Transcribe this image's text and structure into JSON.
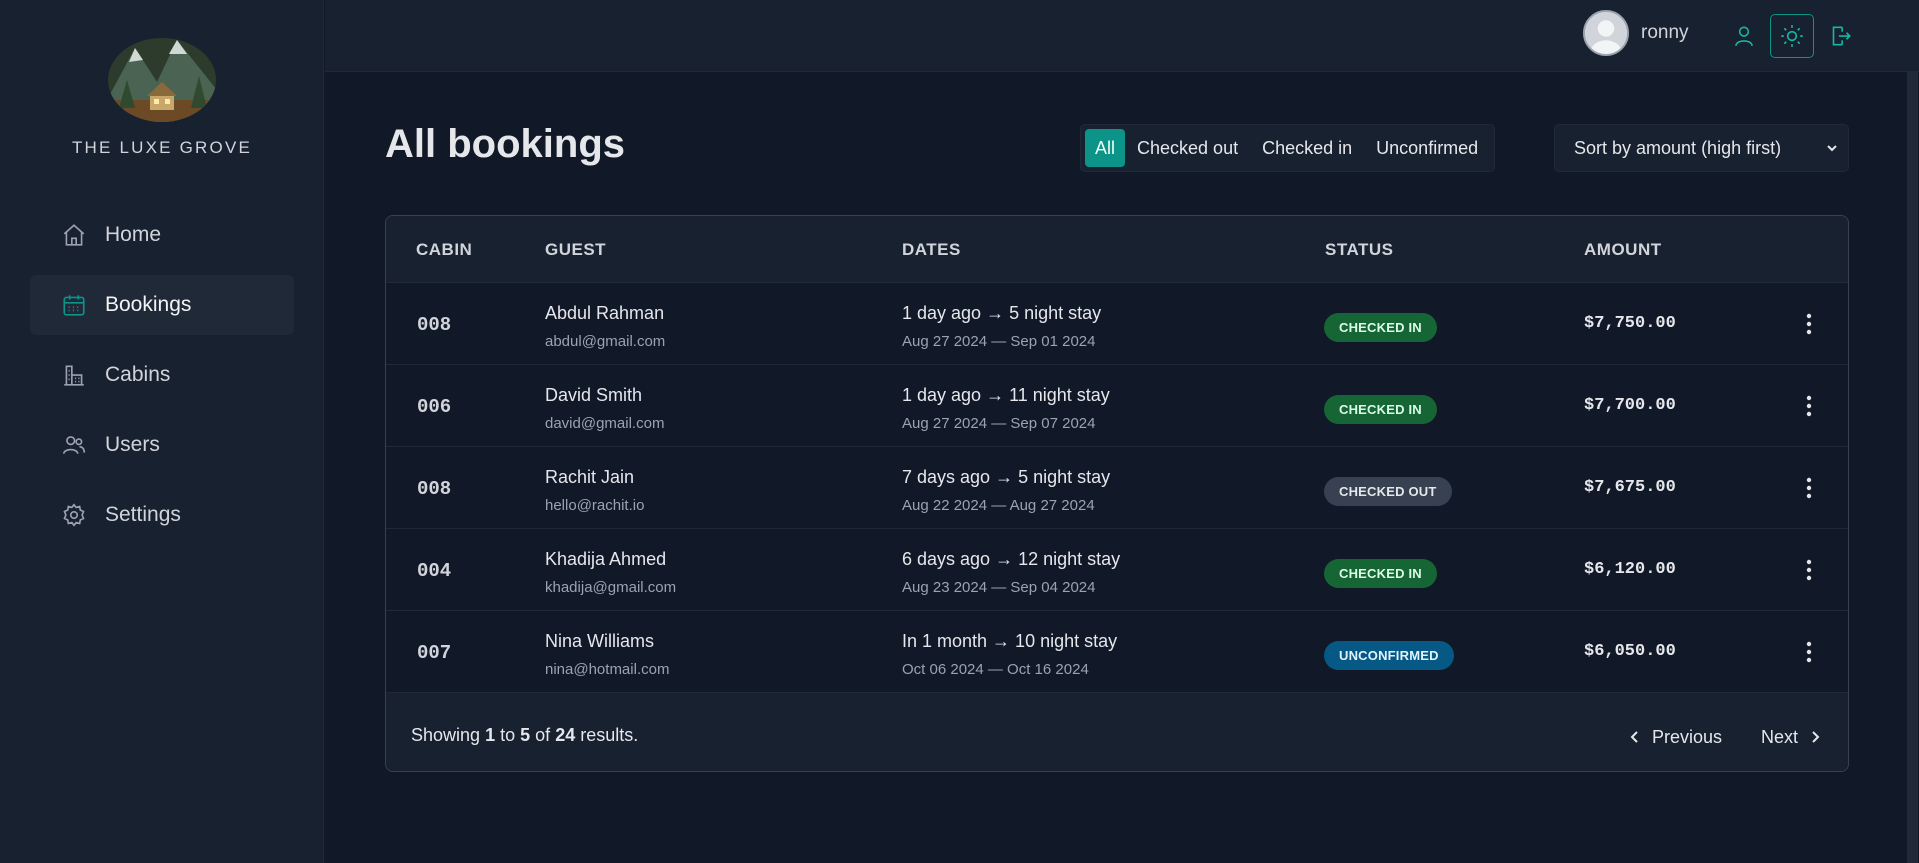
{
  "brand": {
    "name": "THE LUXE GROVE"
  },
  "sidebar": {
    "items": [
      {
        "label": "Home",
        "icon": "home-icon"
      },
      {
        "label": "Bookings",
        "icon": "calendar-icon",
        "active": true
      },
      {
        "label": "Cabins",
        "icon": "building-icon"
      },
      {
        "label": "Users",
        "icon": "users-icon"
      },
      {
        "label": "Settings",
        "icon": "gear-icon"
      }
    ]
  },
  "header": {
    "username": "ronny",
    "buttons": [
      "user-icon",
      "sun-icon",
      "logout-icon"
    ]
  },
  "page": {
    "title": "All bookings"
  },
  "filter": {
    "options": [
      "All",
      "Checked out",
      "Checked in",
      "Unconfirmed"
    ],
    "active": "All"
  },
  "sort": {
    "selected": "Sort by amount (high first)"
  },
  "table": {
    "headers": [
      "CABIN",
      "GUEST",
      "DATES",
      "STATUS",
      "AMOUNT"
    ],
    "rows": [
      {
        "cabin": "008",
        "guest": "Abdul Rahman",
        "email": "abdul@gmail.com",
        "dates": "1 day ago → 5 night stay",
        "range": "Aug 27 2024 — Sep 01 2024",
        "status": "CHECKED IN",
        "amount": "$7,750.00"
      },
      {
        "cabin": "006",
        "guest": "David Smith",
        "email": "david@gmail.com",
        "dates": "1 day ago → 11 night stay",
        "range": "Aug 27 2024 — Sep 07 2024",
        "status": "CHECKED IN",
        "amount": "$7,700.00"
      },
      {
        "cabin": "008",
        "guest": "Rachit Jain",
        "email": "hello@rachit.io",
        "dates": "7 days ago → 5 night stay",
        "range": "Aug 22 2024 — Aug 27 2024",
        "status": "CHECKED OUT",
        "amount": "$7,675.00"
      },
      {
        "cabin": "004",
        "guest": "Khadija Ahmed",
        "email": "khadija@gmail.com",
        "dates": "6 days ago → 12 night stay",
        "range": "Aug 23 2024 — Sep 04 2024",
        "status": "CHECKED IN",
        "amount": "$6,120.00"
      },
      {
        "cabin": "007",
        "guest": "Nina Williams",
        "email": "nina@hotmail.com",
        "dates": "In 1 month → 10 night stay",
        "range": "Oct 06 2024 — Oct 16 2024",
        "status": "UNCONFIRMED",
        "amount": "$6,050.00"
      }
    ]
  },
  "status_colors": {
    "CHECKED IN": {
      "bg": "#166534",
      "fg": "#dcfce7"
    },
    "CHECKED OUT": {
      "bg": "#374151",
      "fg": "#e5e7eb"
    },
    "UNCONFIRMED": {
      "bg": "#075985",
      "fg": "#e0f2fe"
    }
  },
  "footer": {
    "showing_prefix": "Showing",
    "from": "1",
    "to_word": "to",
    "to": "5",
    "of_word": "of",
    "total": "24",
    "suffix": "results.",
    "prev_label": "Previous",
    "next_label": "Next"
  },
  "colors": {
    "accent": "#0d9488",
    "background": "#111827",
    "panel": "#18212f"
  }
}
